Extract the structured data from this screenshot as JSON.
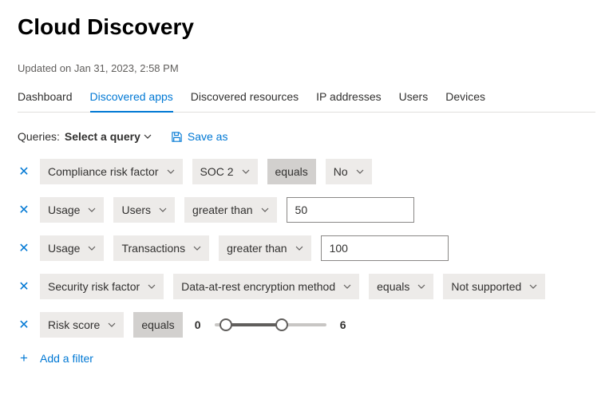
{
  "page_title": "Cloud Discovery",
  "updated_text": "Updated on Jan 31, 2023, 2:58 PM",
  "tabs": [
    "Dashboard",
    "Discovered apps",
    "Discovered resources",
    "IP addresses",
    "Users",
    "Devices"
  ],
  "active_tab_index": 1,
  "queries_label": "Queries:",
  "select_query_label": "Select a query",
  "save_as_label": "Save as",
  "filters": [
    {
      "field": "Compliance risk factor",
      "subfield": "SOC 2",
      "operator": "equals",
      "value_pill": "No"
    },
    {
      "field": "Usage",
      "subfield": "Users",
      "operator": "greater than",
      "value_input": "50"
    },
    {
      "field": "Usage",
      "subfield": "Transactions",
      "operator": "greater than",
      "value_input": "100"
    },
    {
      "field": "Security risk factor",
      "subfield": "Data-at-rest encryption method",
      "operator": "equals",
      "value_pill": "Not supported"
    },
    {
      "field": "Risk score",
      "operator": "equals",
      "slider": {
        "min": 0,
        "max": 6
      }
    }
  ],
  "add_filter_label": "Add a filter"
}
